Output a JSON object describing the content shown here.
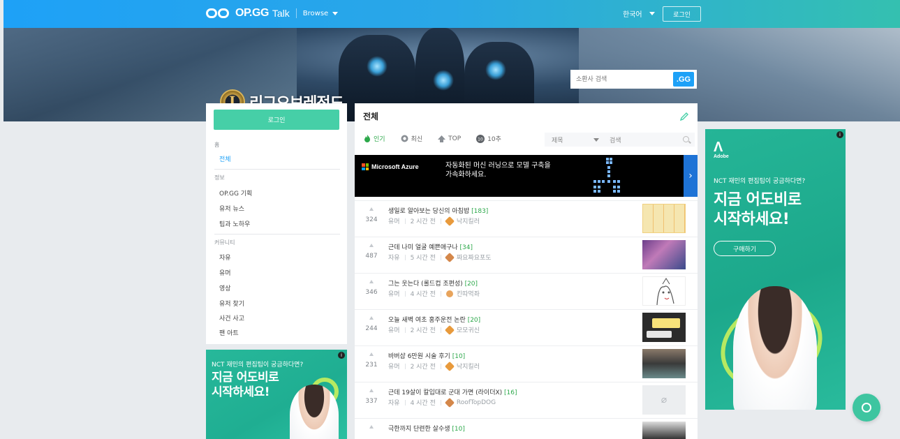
{
  "topbar": {
    "logo_text": "OP.GG",
    "logo_sub": "Talk",
    "browse_label": "Browse",
    "language_label": "한국어",
    "login_label": "로그인"
  },
  "banner": {
    "game_title": "리그오브레전드",
    "search_placeholder": "소환사 검색",
    "search_button": ".GG"
  },
  "sidebar": {
    "login_label": "로그인",
    "sections": [
      {
        "title": "홈",
        "items": [
          {
            "label": "전체",
            "active": true
          }
        ]
      },
      {
        "title": "정보",
        "items": [
          {
            "label": "OP.GG 기획"
          },
          {
            "label": "유저 뉴스"
          },
          {
            "label": "팁과 노하우"
          }
        ]
      },
      {
        "title": "커뮤니티",
        "items": [
          {
            "label": "자유"
          },
          {
            "label": "유머"
          },
          {
            "label": "영상"
          },
          {
            "label": "유저 찾기"
          },
          {
            "label": "사건 사고"
          },
          {
            "label": "팬 아트"
          }
        ]
      }
    ]
  },
  "ad_left": {
    "question": "NCT 재민의 편집팁이 궁금하다면?",
    "headline_1": "지금 어도비로",
    "headline_2": "시작하세요!"
  },
  "main": {
    "title": "전체",
    "tabs": [
      {
        "label": "인기",
        "icon": "fire-icon",
        "active": true
      },
      {
        "label": "최신",
        "icon": "clock-icon"
      },
      {
        "label": "TOP",
        "icon": "top-icon"
      },
      {
        "label": "10추",
        "icon": "ten-badge-icon"
      }
    ],
    "filter_select": "제목",
    "search_placeholder": "검색",
    "inline_ad": {
      "brand": "Microsoft Azure",
      "line1": "자동화된 머신 러닝으로 모델 구축을",
      "line2": "가속화하세요.",
      "close_label": "ⓘX"
    },
    "posts": [
      {
        "votes": "324",
        "title": "생일로 알아보는 당신의 아침밥",
        "comments": "[183]",
        "category": "유머",
        "time": "2 시간 전",
        "author": "낙지킬러",
        "tier_color": "#e89a3c"
      },
      {
        "votes": "487",
        "title": "근데 나미 얼굴 예쁜애구나",
        "comments": "[34]",
        "category": "자유",
        "time": "5 시간 전",
        "author": "짜요짜요포도",
        "tier_color": "#d4874a"
      },
      {
        "votes": "346",
        "title": "그는 웃는다 (롤드컵 조편성)",
        "comments": "[20]",
        "category": "유머",
        "time": "4 시간 전",
        "author": "킨따먹좌",
        "tier_color": "#e8a45c"
      },
      {
        "votes": "244",
        "title": "오늘 새벽 여초 홍주운전 논란",
        "comments": "[20]",
        "category": "유머",
        "time": "2 시간 전",
        "author": "모모귀신",
        "tier_color": "#e89a3c"
      },
      {
        "votes": "231",
        "title": "바버샵 6만원 시술 후기",
        "comments": "[10]",
        "category": "유머",
        "time": "2 시간 전",
        "author": "낙지킬러",
        "tier_color": "#e89a3c"
      },
      {
        "votes": "337",
        "title": "근데 19살이 칼입대로 군대 가면 (라이더X)",
        "comments": "[16]",
        "category": "자유",
        "time": "4 시간 전",
        "author": "RoofTopDOG",
        "tier_color": "#d4874a"
      },
      {
        "votes": "",
        "title": "극한까지 단련한 살수생",
        "comments": "[10]",
        "category": "",
        "time": "",
        "author": "",
        "tier_color": "#e89a3c"
      }
    ]
  },
  "ad_right": {
    "brand": "Adobe",
    "question": "NCT 재민의 편집팁이 궁금하다면?",
    "headline_1": "지금 어도비로",
    "headline_2": "시작하세요!",
    "button": "구매하기"
  },
  "colors": {
    "accent_blue": "#1ea1f7",
    "accent_green": "#46cfa7",
    "comment_green": "#2ca84a"
  }
}
